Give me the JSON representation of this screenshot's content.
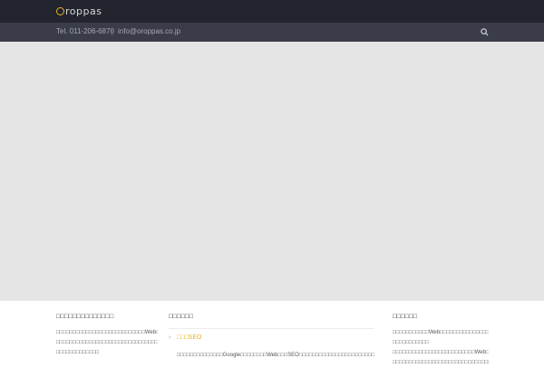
{
  "header": {
    "logo_text": "roppas",
    "tel": "Tel. 011-206-6870",
    "email": "info@oroppas.co.jp"
  },
  "colors": {
    "accent": "#e6b325",
    "topbar": "#22252e",
    "infobar": "#3a3d49",
    "hero": "#e5e5e5"
  },
  "footer": {
    "col1": {
      "title": "□□□□□□□□□□□□□□",
      "lines": [
        "□□□□□□□□□□□□□□□□□□□□□□□□□□□Web□□□",
        "□□□□□□□□□□□□□□□□□□□□□□□□□□□□□□□□□",
        "□□□□□□□□□□□□□"
      ]
    },
    "col2": {
      "title": "□□□□□□",
      "link": "□□□SEO",
      "lines": [
        "□□□□□□□□□□□□□□Google□□□□□□□□Web□□□SEO□□□□□□□□□□□□□□□□□□□□□□□□□□"
      ]
    },
    "col3": {
      "title": "□□□□□□",
      "lines": [
        "□□□□□□□□□□□Web□□□□□□□□□□□□□□□□□□□",
        "□□□□□□□□□□□",
        "□□□□□□□□□□□□□□□□□□□□□□□□□Web□□□□",
        "□□□□□□□□□□□□□□□□□□□□□□□□□□□□□□□□"
      ]
    }
  }
}
